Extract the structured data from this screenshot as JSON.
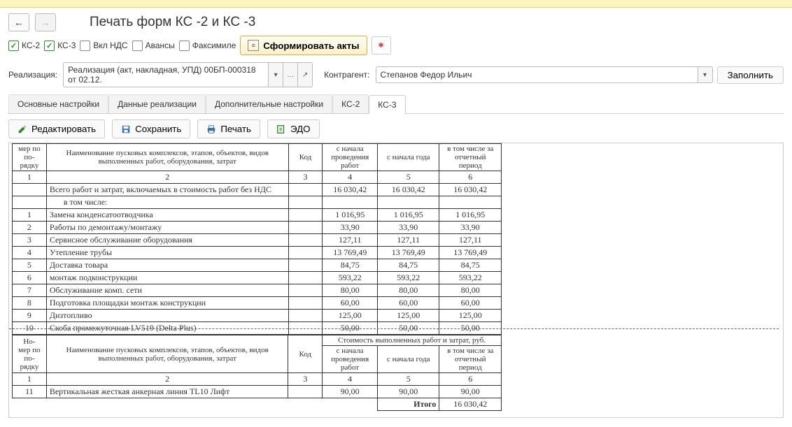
{
  "title": "Печать форм КС -2 и КС -3",
  "toolbar": {
    "ks2_label": "КС-2",
    "ks3_label": "КС-3",
    "nds_label": "Вкл НДС",
    "advances_label": "Авансы",
    "fax_label": "Факсимиле",
    "generate_btn": "Сформировать акты"
  },
  "filters": {
    "realization_label": "Реализация:",
    "realization_value": "Реализация (акт, накладная, УПД) 00БП-000318 от 02.12.",
    "contragent_label": "Контрагент:",
    "contragent_value": "Степанов Федор Ильич",
    "fill_btn": "Заполнить"
  },
  "tabs": [
    "Основные настройки",
    "Данные реализации",
    "Дополнительные настройки",
    "КС-2",
    "КС-3"
  ],
  "print_toolbar": {
    "edit": "Редактировать",
    "save": "Сохранить",
    "print": "Печать",
    "edo": "ЭДО"
  },
  "doc": {
    "h_num": "мер по по-рядку",
    "h_name_cut": "Наименование пусковых комплексов, этапов, объектов, видов выполненных работ, оборудования, затрат",
    "h_code": "Код",
    "h_from_start": "с начала проведения работ",
    "h_from_year": "с начала года",
    "h_period": "в том числе за отчетный период",
    "h_num_1": "1",
    "h_num_2": "2",
    "h_num_3": "3",
    "h_num_4": "4",
    "h_num_5": "5",
    "h_num_6": "6",
    "total_works": "Всего работ и затрат, включаемых в стоимость работ без НДС",
    "including": "в том числе:",
    "cost_header": "Стоимость выполненных работ и затрат, руб.",
    "h_name_full": "Наименование пусковых комплексов, этапов, объектов, видов выполненных работ, оборудования, затрат",
    "itogo": "Итого",
    "total_val": "16 030,42"
  },
  "rows": [
    {
      "n": "1",
      "name": "Замена конденсатоотводчика",
      "v": "1 016,95"
    },
    {
      "n": "2",
      "name": "Работы по демонтажу/монтажу",
      "v": "33,90"
    },
    {
      "n": "3",
      "name": "Сервисное обслуживание оборудования",
      "v": "127,11"
    },
    {
      "n": "4",
      "name": "Утепление трубы",
      "v": "13 769,49"
    },
    {
      "n": "5",
      "name": "Доставка товара",
      "v": "84,75"
    },
    {
      "n": "6",
      "name": "монтаж подконструкции",
      "v": "593,22"
    },
    {
      "n": "7",
      "name": "Обслуживание комп. сети",
      "v": "80,00"
    },
    {
      "n": "8",
      "name": "Подготовка площадки монтаж конструкции",
      "v": "60,00"
    },
    {
      "n": "9",
      "name": "Дизтопливо",
      "v": "125,00"
    },
    {
      "n": "10",
      "name": "Скоба промежуточная LV519 (Delta Plus)",
      "v": "50,00"
    }
  ],
  "row11": {
    "n": "11",
    "name": "Вертикальная жесткая анкерная линия TL10 Лифт",
    "v": "90,00"
  }
}
